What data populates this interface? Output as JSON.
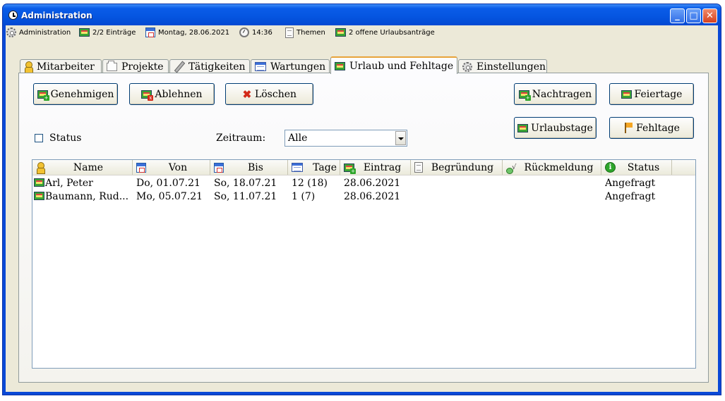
{
  "window": {
    "title": "Administration"
  },
  "statusbar": {
    "admin": "Administration",
    "entries": "2/2 Einträge",
    "date": "Montag, 28.06.2021",
    "time": "14:36",
    "themes": "Themen",
    "requests": "2 offene Urlaubsanträge"
  },
  "tabs": [
    {
      "label": "Mitarbeiter",
      "icon": "person-icon"
    },
    {
      "label": "Projekte",
      "icon": "folder-icon"
    },
    {
      "label": "Tätigkeiten",
      "icon": "pencil-icon"
    },
    {
      "label": "Wartungen",
      "icon": "table-icon"
    },
    {
      "label": "Urlaub und Fehltage",
      "icon": "envelope-icon",
      "active": true
    },
    {
      "label": "Einstellungen",
      "icon": "gear-icon"
    }
  ],
  "toolbar": {
    "approve": "Genehmigen",
    "reject": "Ablehnen",
    "delete": "Löschen",
    "add_later": "Nachtragen",
    "holidays": "Feiertage",
    "vacation_days": "Urlaubstage",
    "absence_days": "Fehltage"
  },
  "filters": {
    "status_label": "Status",
    "status_checked": false,
    "period_label": "Zeitraum:",
    "period_value": "Alle"
  },
  "table": {
    "columns": [
      "Name",
      "Von",
      "Bis",
      "Tage",
      "Eintrag",
      "Begründung",
      "Rückmeldung",
      "Status"
    ],
    "rows": [
      {
        "name": "Arl, Peter",
        "from": "Do, 01.07.21",
        "to": "So, 18.07.21",
        "days": "12 (18)",
        "entry": "28.06.2021",
        "reason": "",
        "feedback": "",
        "status": "Angefragt"
      },
      {
        "name": "Baumann, Rud...",
        "from": "Mo, 05.07.21",
        "to": "So, 11.07.21",
        "days": "1 (7)",
        "entry": "28.06.2021",
        "reason": "",
        "feedback": "",
        "status": "Angefragt"
      }
    ]
  },
  "colors": {
    "titlebar": "#0555e0",
    "window_bg": "#ece9d8",
    "active_tab_accent": "#e8a43a",
    "button_border": "#003c74"
  }
}
